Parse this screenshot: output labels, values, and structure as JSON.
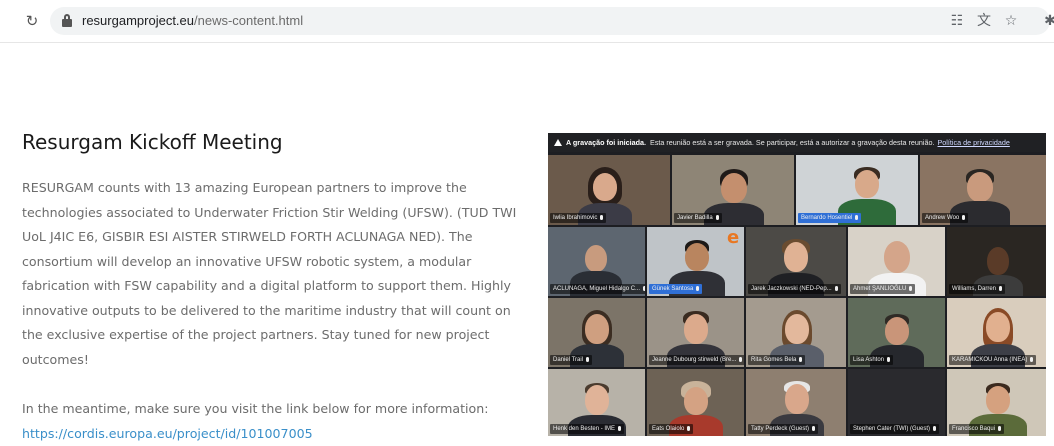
{
  "browser": {
    "reload_icon": "reload-icon",
    "lock_icon": "lock-icon",
    "url_host": "resurgamproject.eu",
    "url_path": "/news-content.html",
    "right_icons": [
      "qr-code-icon",
      "translate-icon",
      "star-icon",
      "extensions-icon"
    ]
  },
  "article": {
    "title": "Resurgam Kickoff Meeting",
    "paragraph1": "RESURGAM counts with 13 amazing European partners to improve the technologies associated to Underwater Friction Stir Welding (UFSW). (TUD TWI UoL J4IC E6, GISBIR ESI AISTER STIRWELD FORTH ACLUNAGA NED). The consortium will develop an innovative UFSW robotic system, a modular fabrication with FSW capability and a digital platform to support them. Highly innovative outputs to be delivered to the maritime industry that will count on the exclusive expertise of the project partners. Stay tuned for new project outcomes!",
    "paragraph2": "In the meantime, make sure you visit the link below for more information:",
    "link": "https://cordis.europa.eu/project/id/101007005"
  },
  "call": {
    "banner_bold": "A gravação foi iniciada.",
    "banner_text": "Esta reunião está a ser gravada. Se participar, está a autorizar a gravação desta reunião.",
    "banner_link": "Política de privacidade",
    "participants": [
      [
        "Iwlia Ibrahimovic",
        "Javier Badilla",
        "Bernardo Hosentiel",
        "Andrew Woo"
      ],
      [
        "ACLUNAGA, Miguel Hidalgo C...",
        "Günek Santosa",
        "Jarek Jaczkowski (NED-Pep...",
        "Ahmet ŞANLIOĞLU",
        "Williams, Darren"
      ],
      [
        "Daniel Trail",
        "Jeanne Dubourg stirweld (Bre...",
        "Rita Gomes Bela",
        "Lisa Ashton",
        "KARAMICKOU Anna (INEA)"
      ],
      [
        "Henk den Besten - IME",
        "Eats Olaiolo",
        "Tatty Perdeck (Guest)",
        "Stephen Cater (TWI) (Guest)",
        "Francisco Baqui"
      ]
    ],
    "brand_letter": "e"
  }
}
